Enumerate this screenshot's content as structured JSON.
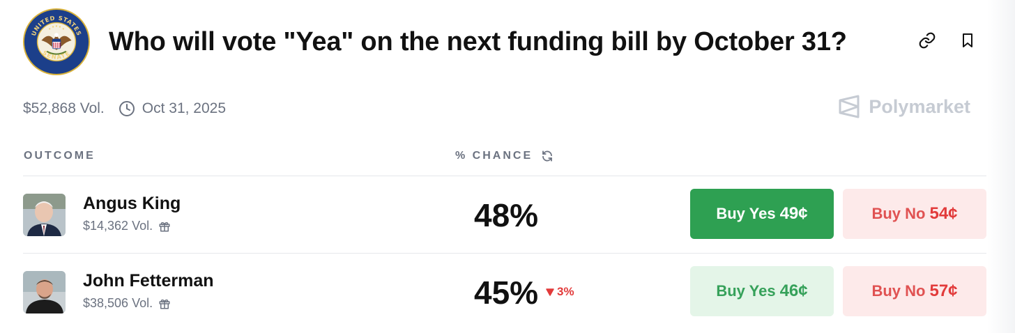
{
  "market": {
    "title": "Who will vote \"Yea\" on the next funding bill by October 31?",
    "volume": "$52,868 Vol.",
    "end_date": "Oct 31, 2025",
    "seal_text_top": "UNITED STATES",
    "seal_text_bottom": "SENATE"
  },
  "brand": {
    "name": "Polymarket"
  },
  "columns": {
    "outcome": "OUTCOME",
    "chance": "% CHANCE"
  },
  "outcomes": [
    {
      "name": "Angus King",
      "volume": "$14,362 Vol.",
      "chance": "48%",
      "delta": "",
      "buy_yes_label": "Buy Yes",
      "buy_yes_price": "49¢",
      "buy_no_label": "Buy No",
      "buy_no_price": "54¢"
    },
    {
      "name": "John Fetterman",
      "volume": "$38,506 Vol.",
      "chance": "45%",
      "delta": "3%",
      "buy_yes_label": "Buy Yes",
      "buy_yes_price": "46¢",
      "buy_no_label": "Buy No",
      "buy_no_price": "57¢"
    }
  ],
  "icons": {
    "header": [
      "link-icon",
      "bookmark-icon"
    ],
    "meta": "clock-icon",
    "column": "refresh-icon",
    "volume": "gift-icon",
    "delta": "down-triangle-icon"
  },
  "colors": {
    "yes_green": "#2ea052",
    "yes_soft_bg": "#e4f5e8",
    "no_red": "#e23b3b",
    "no_soft_bg": "#fdeaea",
    "muted_text": "#6b7280",
    "seal_blue": "#1c3f8a",
    "seal_gold": "#d9b23a"
  }
}
